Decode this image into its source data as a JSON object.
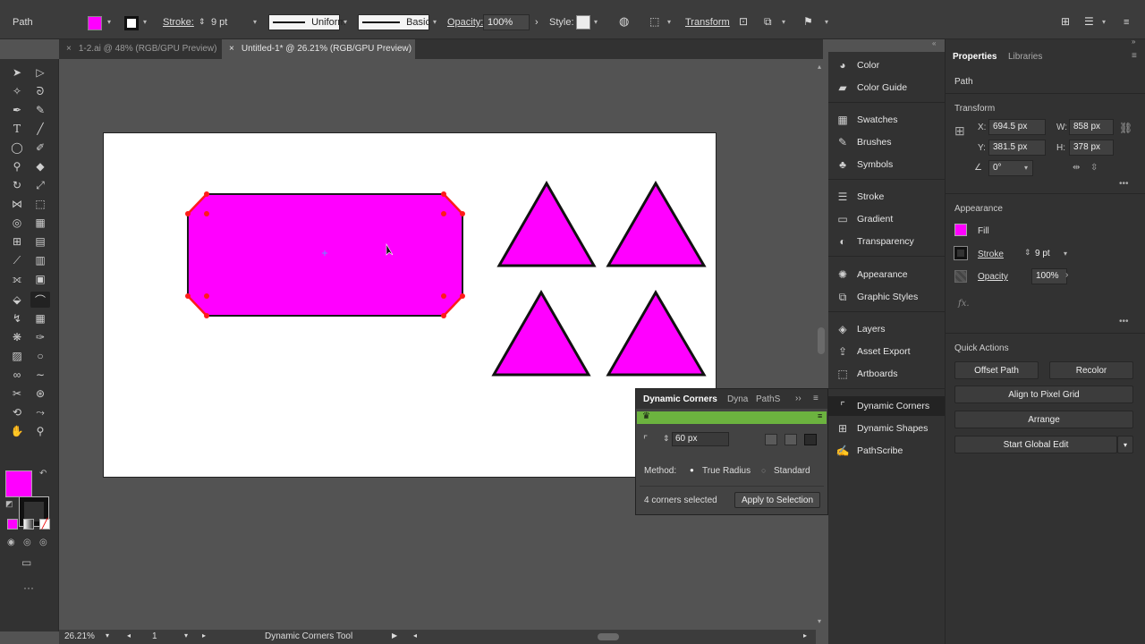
{
  "control_bar": {
    "object_type": "Path",
    "stroke_label": "Stroke:",
    "stroke_value": "9 pt",
    "profile": "Uniform",
    "brush": "Basic",
    "opacity_label": "Opacity:",
    "opacity_value": "100%",
    "style_label": "Style:",
    "transform_label": "Transform",
    "fill_color": "#ff00ff"
  },
  "tabs": [
    {
      "close": "×",
      "label": "1-2.ai @ 48% (RGB/GPU Preview)"
    },
    {
      "close": "×",
      "label": "Untitled-1* @ 26.21% (RGB/GPU Preview)"
    }
  ],
  "status_bar": {
    "zoom": "26.21%",
    "artboard_number": "1",
    "current_tool": "Dynamic Corners Tool"
  },
  "panels": {
    "color": "Color",
    "color_guide": "Color Guide",
    "swatches": "Swatches",
    "brushes": "Brushes",
    "symbols": "Symbols",
    "stroke": "Stroke",
    "gradient": "Gradient",
    "transparency": "Transparency",
    "appearance": "Appearance",
    "graphic_styles": "Graphic Styles",
    "layers": "Layers",
    "asset_export": "Asset Export",
    "artboards": "Artboards",
    "dynamic_corners": "Dynamic Corners",
    "dynamic_shapes": "Dynamic Shapes",
    "pathscribe": "PathScribe"
  },
  "properties": {
    "tab_properties": "Properties",
    "tab_libraries": "Libraries",
    "selection": "Path",
    "transform_title": "Transform",
    "x_label": "X:",
    "x_value": "694.5 px",
    "y_label": "Y:",
    "y_value": "381.5 px",
    "w_label": "W:",
    "w_value": "858 px",
    "h_label": "H:",
    "h_value": "378 px",
    "angle_value": "0°",
    "appearance_title": "Appearance",
    "fill_label": "Fill",
    "stroke_label": "Stroke",
    "stroke_value": "9 pt",
    "opacity_label": "Opacity",
    "opacity_value": "100%",
    "fx": "fx.",
    "quick_actions_title": "Quick Actions",
    "offset_path": "Offset Path",
    "recolor": "Recolor",
    "align_pixel": "Align to Pixel Grid",
    "arrange": "Arrange",
    "global_edit": "Start Global Edit"
  },
  "dynamic_corners_panel": {
    "tab1": "Dynamic Corners",
    "tab2": "Dyna",
    "tab3": "PathS",
    "radius": "60 px",
    "method_label": "Method:",
    "true_radius": "True Radius",
    "standard": "Standard",
    "status": "4 corners selected",
    "apply": "Apply to Selection"
  },
  "colors": {
    "magenta": "#ff00ff",
    "corner_widget": "#ff0000",
    "panel_accent": "#6cb33f"
  }
}
